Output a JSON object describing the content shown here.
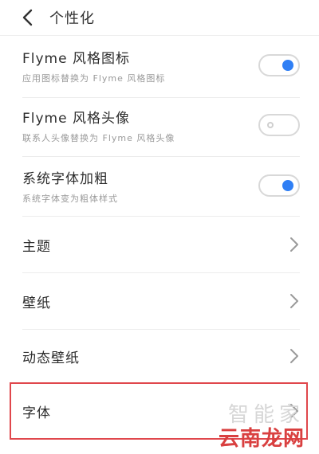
{
  "header": {
    "title": "个性化",
    "back_icon": "chevron-left-icon"
  },
  "settings": {
    "flyme_icons": {
      "title": "Flyme 风格图标",
      "subtitle": "应用图标替换为 Flyme 风格图标",
      "enabled": true
    },
    "flyme_avatar": {
      "title": "Flyme 风格头像",
      "subtitle": "联系人头像替换为 Flyme 风格头像",
      "enabled": false
    },
    "bold_font": {
      "title": "系统字体加粗",
      "subtitle": "系统字体变为粗体样式",
      "enabled": true
    },
    "theme": {
      "title": "主题"
    },
    "wallpaper": {
      "title": "壁纸"
    },
    "live_wallpaper": {
      "title": "动态壁纸"
    },
    "font": {
      "title": "字体"
    }
  },
  "watermark": {
    "top": "智能家",
    "bottom": "云南龙网"
  },
  "colors": {
    "accent": "#2f7ff5",
    "highlight_border": "#e0474c",
    "watermark_red": "#d94040"
  }
}
